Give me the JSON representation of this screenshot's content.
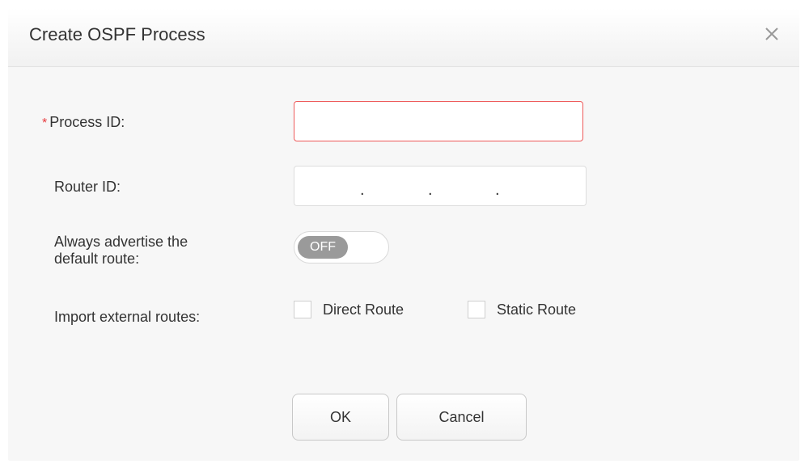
{
  "dialog": {
    "title": "Create OSPF Process",
    "close_icon": "close-icon"
  },
  "form": {
    "required_marker": "*",
    "process_id": {
      "label": "Process ID:",
      "value": "",
      "placeholder": ""
    },
    "router_id": {
      "label": "Router ID:",
      "segments": [
        "",
        "",
        "",
        ""
      ],
      "separator": "."
    },
    "default_route": {
      "label_line1": "Always advertise the",
      "label_line2": "default route:",
      "state": "OFF"
    },
    "import_routes": {
      "label": "Import external routes:",
      "options": [
        {
          "label": "Direct Route",
          "checked": false
        },
        {
          "label": "Static Route",
          "checked": false
        }
      ]
    }
  },
  "buttons": {
    "ok": "OK",
    "cancel": "Cancel"
  },
  "colors": {
    "error_border": "#ee5a5a",
    "required": "#e8393d",
    "toggle_off": "#9a9a9a"
  }
}
